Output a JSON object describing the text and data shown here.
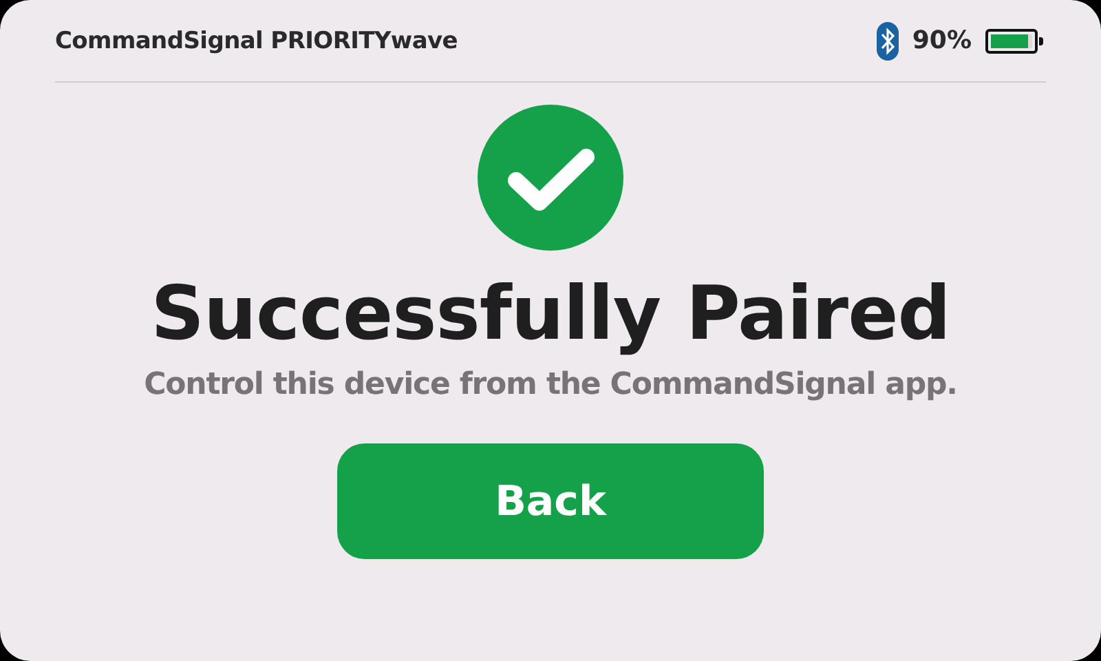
{
  "header": {
    "title": "CommandSignal PRIORITYwave",
    "battery_text": "90%",
    "battery": {
      "level": 0.9
    }
  },
  "status": {
    "title": "Successfully Paired",
    "message": "Control this device from the CommandSignal app."
  },
  "buttons": [
    "Back"
  ]
}
